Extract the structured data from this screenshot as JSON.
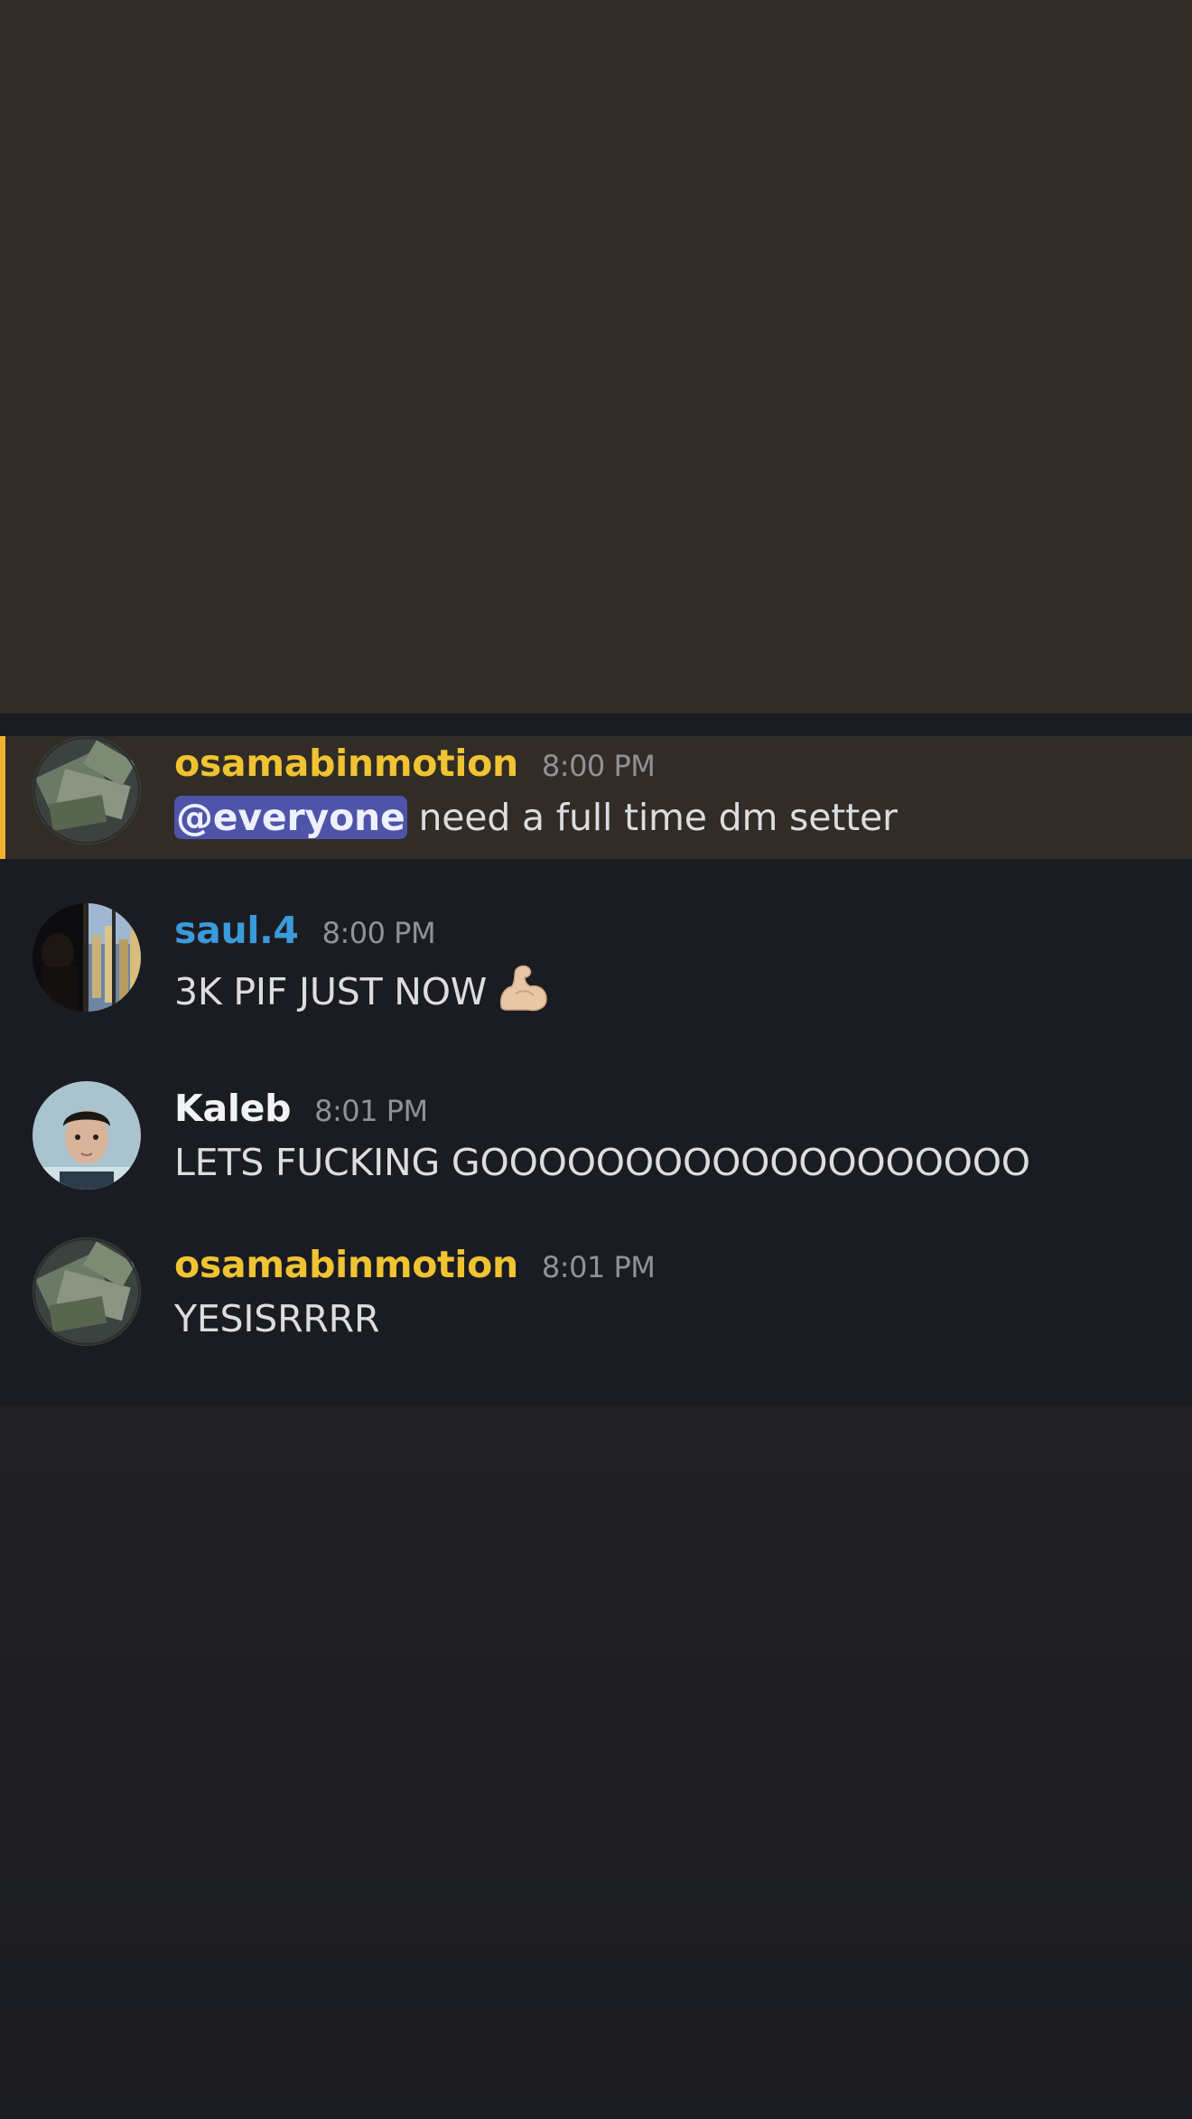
{
  "messages": [
    {
      "author": "osamabinmotion",
      "time": "8:00 PM",
      "mention": "@everyone",
      "text": "need a full time dm setter",
      "author_color": "#f0c332",
      "highlighted": true,
      "avatar": "money-stack-avatar"
    },
    {
      "author": "saul.4",
      "time": "8:00 PM",
      "text": "3K PIF JUST NOW",
      "emoji": "flexed-biceps-icon",
      "author_color": "#3b9ad8",
      "avatar": "city-window-avatar"
    },
    {
      "author": "Kaleb",
      "time": "8:01 PM",
      "text": "LETS FUCKING GOOOOOOOOOOOOOOOOOOO",
      "author_color": "#f2f3f5",
      "avatar": "portrait-avatar"
    },
    {
      "author": "osamabinmotion",
      "time": "8:01 PM",
      "text": "YESISRRRR",
      "author_color": "#f0c332",
      "avatar": "money-stack-avatar"
    }
  ],
  "colors": {
    "mention_highlight_bar": "#f0b232",
    "mention_pill": "#4e54a8",
    "chat_background": "#1b1c22"
  }
}
